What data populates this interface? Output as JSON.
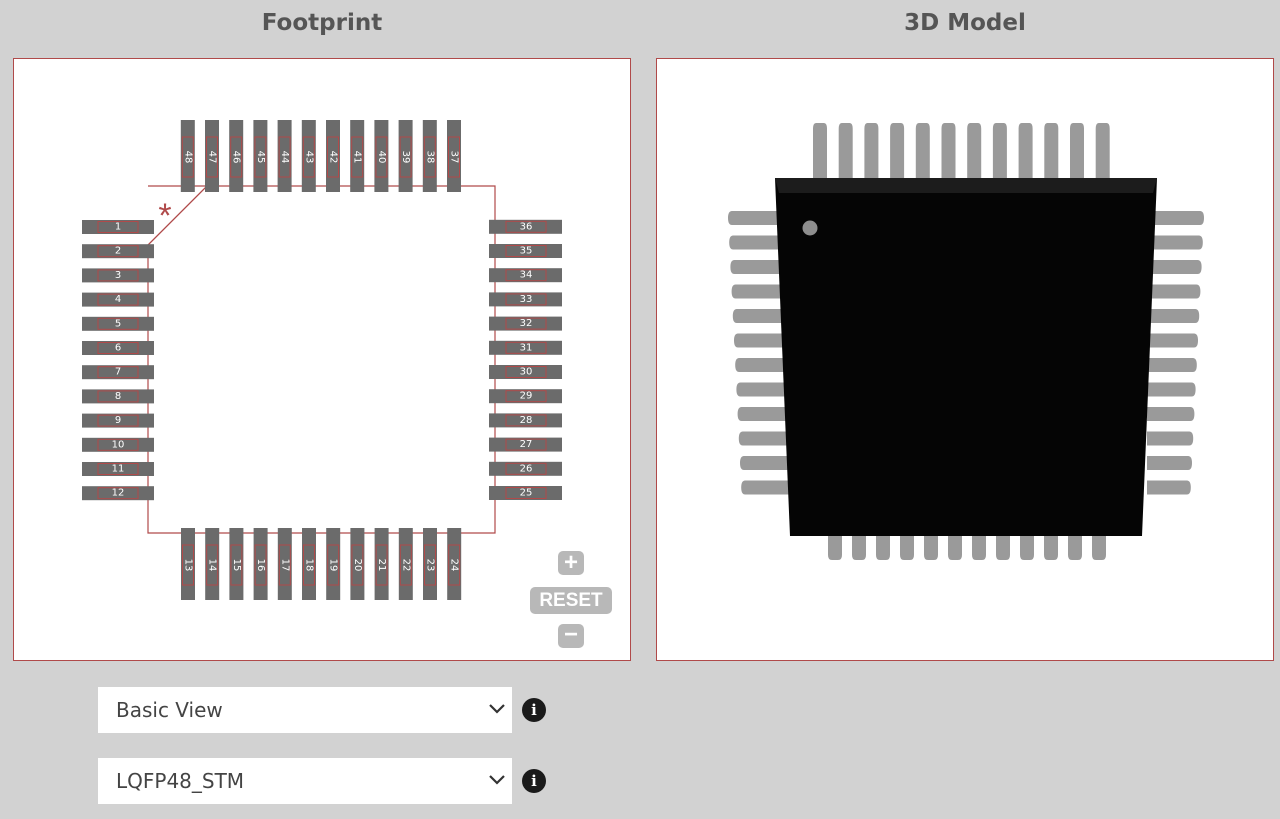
{
  "headings": {
    "footprint": "Footprint",
    "model3d": "3D Model"
  },
  "footprint": {
    "pins_left": [
      "1",
      "2",
      "3",
      "4",
      "5",
      "6",
      "7",
      "8",
      "9",
      "10",
      "11",
      "12"
    ],
    "pins_bottom": [
      "13",
      "14",
      "15",
      "16",
      "17",
      "18",
      "19",
      "20",
      "21",
      "22",
      "23",
      "24"
    ],
    "pins_right": [
      "25",
      "26",
      "27",
      "28",
      "29",
      "30",
      "31",
      "32",
      "33",
      "34",
      "35",
      "36"
    ],
    "pins_top": [
      "37",
      "38",
      "39",
      "40",
      "41",
      "42",
      "43",
      "44",
      "45",
      "46",
      "47",
      "48"
    ],
    "pin1_marker": "*",
    "zoom": {
      "plus": "+",
      "reset": "RESET",
      "minus": "−"
    }
  },
  "view_select": {
    "value": "Basic View"
  },
  "package_select": {
    "value": "LQFP48_STM"
  },
  "icons": {
    "info": "info-icon",
    "chevron": "chevron-down-icon"
  },
  "colors": {
    "outline": "#b04a4a",
    "pad": "#6b6b6b",
    "chip_body": "#0c0c0c",
    "lead": "#9a9a9a"
  }
}
